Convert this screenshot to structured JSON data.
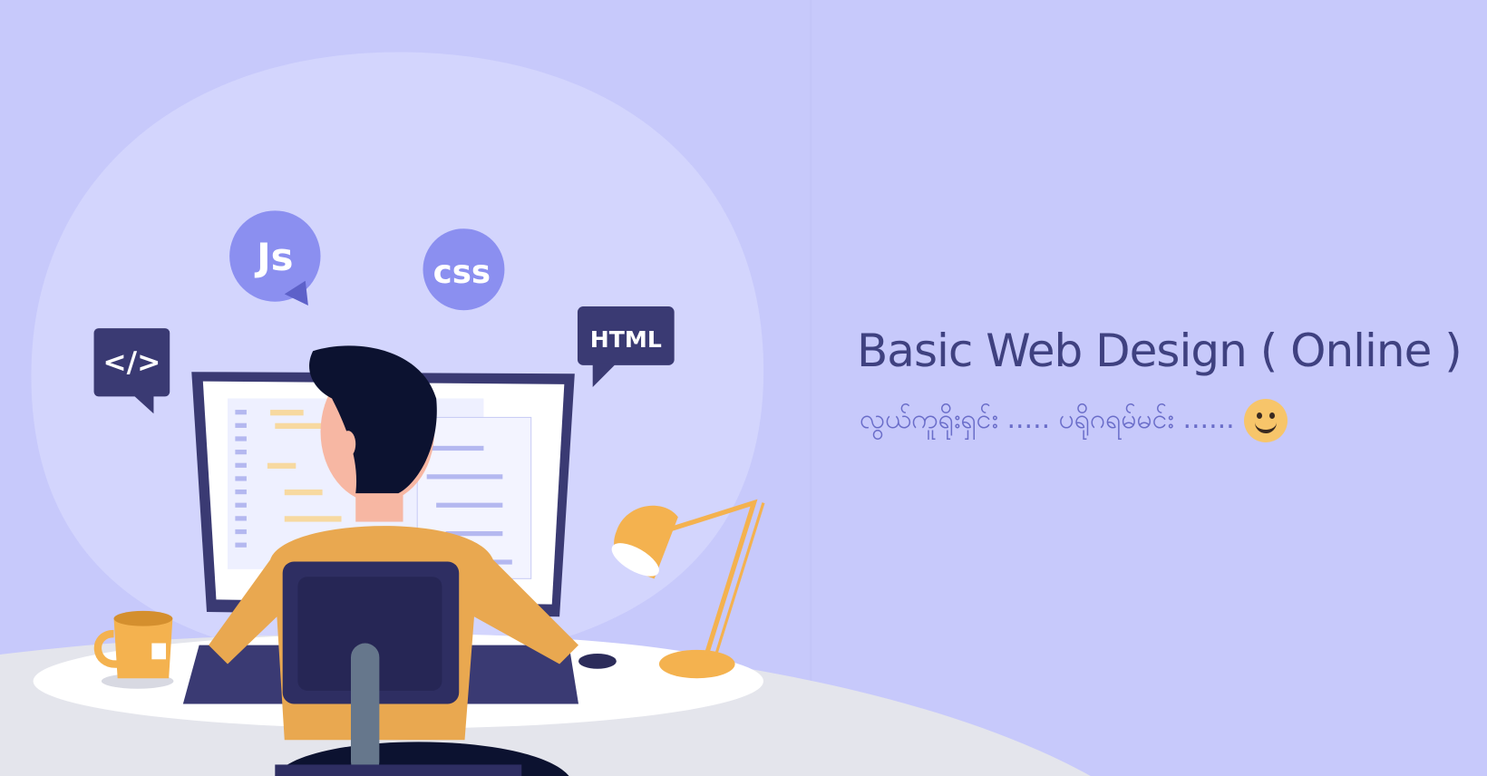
{
  "banner": {
    "title": "Basic Web Design ( Online )",
    "subtitle": "လွယ်ကူရိုးရှင်း ..... ပရိုဂရမ်မင်း ......",
    "emoji": "smiley-face"
  },
  "bubbles": {
    "js": "Js",
    "css": "css",
    "html": "HTML",
    "code": "</>"
  },
  "colors": {
    "background": "#c7c9fb",
    "blob": "#d3d5fd",
    "title": "#3f4180",
    "subtitle": "#6a6dc9",
    "accent": "#f4b24f",
    "navy": "#3a3a73"
  }
}
